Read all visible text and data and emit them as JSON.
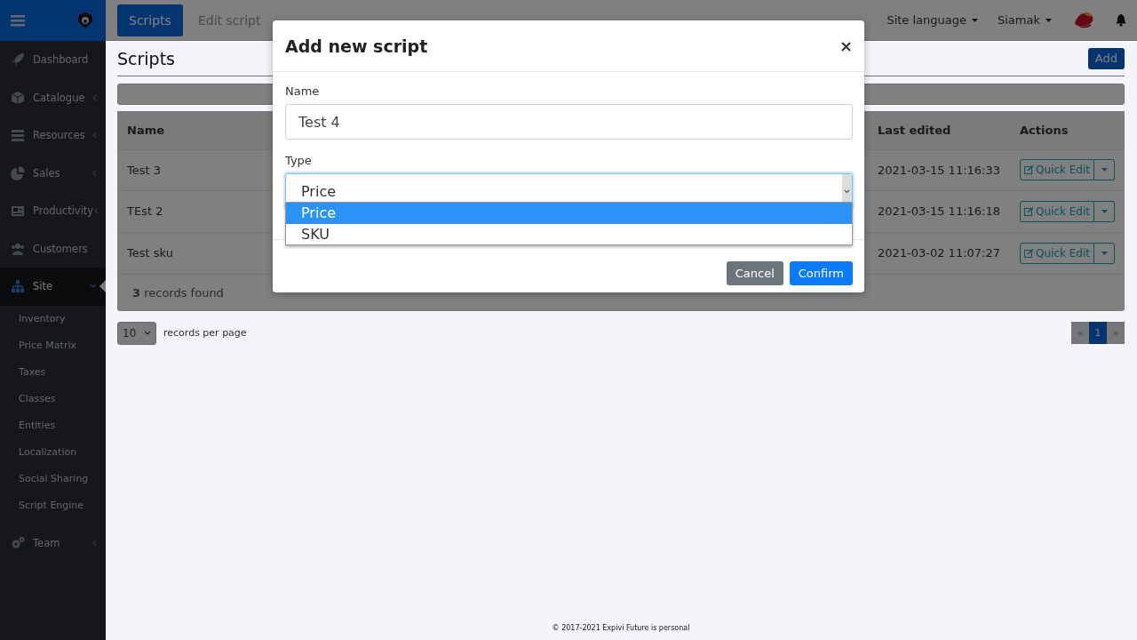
{
  "sidebar": {
    "items": [
      {
        "label": "Dashboard",
        "expandable": false,
        "selected": false
      },
      {
        "label": "Catalogue",
        "expandable": true,
        "expanded": false,
        "selected": false
      },
      {
        "label": "Resources",
        "expandable": true,
        "expanded": false,
        "selected": false
      },
      {
        "label": "Sales",
        "expandable": true,
        "expanded": false,
        "selected": false
      },
      {
        "label": "Productivity",
        "expandable": true,
        "expanded": false,
        "selected": false
      },
      {
        "label": "Customers",
        "expandable": false,
        "selected": false
      },
      {
        "label": "Site",
        "expandable": true,
        "expanded": true,
        "selected": true,
        "children": [
          {
            "label": "Inventory"
          },
          {
            "label": "Price Matrix"
          },
          {
            "label": "Taxes"
          },
          {
            "label": "Classes"
          },
          {
            "label": "Entities"
          },
          {
            "label": "Localization"
          },
          {
            "label": "Social Sharing"
          },
          {
            "label": "Script Engine"
          }
        ]
      },
      {
        "label": "Team",
        "expandable": true,
        "expanded": false,
        "selected": false
      }
    ]
  },
  "tabs": [
    {
      "label": "Scripts",
      "selected": true
    },
    {
      "label": "Edit script",
      "selected": false
    }
  ],
  "topbar": {
    "menus": [
      "Site language",
      "Siamak"
    ]
  },
  "page": {
    "title": "Scripts",
    "add_button": "Add"
  },
  "table": {
    "columns": [
      "Name",
      "Last edited",
      "Actions"
    ],
    "rows": [
      {
        "name": "Test 3",
        "last_edited": "2021-03-15 11:16:33",
        "action": "Quick Edit"
      },
      {
        "name": "TEst 2",
        "last_edited": "2021-03-15 11:16:18",
        "action": "Quick Edit"
      },
      {
        "name": "Test sku",
        "last_edited": "2021-03-02 11:07:27",
        "action": "Quick Edit"
      }
    ],
    "summary": "**3** records found"
  },
  "pager": {
    "per_page": "10",
    "per_page_label": "records per page",
    "pages": [
      {
        "label": "«",
        "selected": false
      },
      {
        "label": "1",
        "selected": true
      },
      {
        "label": "»",
        "selected": false
      }
    ]
  },
  "footer": "© 2017-2021 Expivi Future is personal",
  "modal": {
    "title": "Add new script",
    "close": "×",
    "name_label": "Name",
    "name_value": "Test 4",
    "type_label": "Type",
    "type_value": "Price",
    "type_options": [
      {
        "label": "Price",
        "selected": true
      },
      {
        "label": "SKU",
        "selected": false
      }
    ],
    "buttons": [
      {
        "label": "Cancel",
        "kind": "secondary"
      },
      {
        "label": "Confirm",
        "kind": "primary"
      }
    ]
  }
}
